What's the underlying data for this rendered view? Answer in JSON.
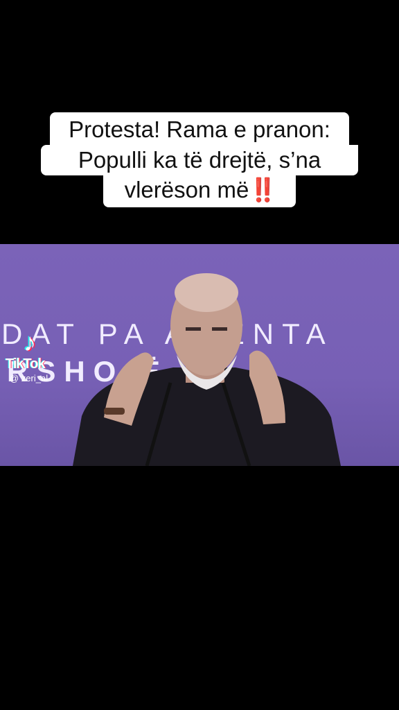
{
  "caption": {
    "line1": "Protesta! Rama e pranon:",
    "line2": "Populli ka të drejtë, s’na",
    "line3": "vlerëson më",
    "emoji": "‼️"
  },
  "video": {
    "backdrop_line1": "DAT PA  AMENTA",
    "backdrop_line2": "RSHO    Ë 20"
  },
  "watermark": {
    "brand": "TikTok",
    "username": "@ zeri_al",
    "icon": "tiktok-note-icon"
  },
  "colors": {
    "background": "#000000",
    "caption_bg": "#ffffff",
    "video_backdrop": "#7b63b8",
    "emoji_red": "#e0191b"
  }
}
